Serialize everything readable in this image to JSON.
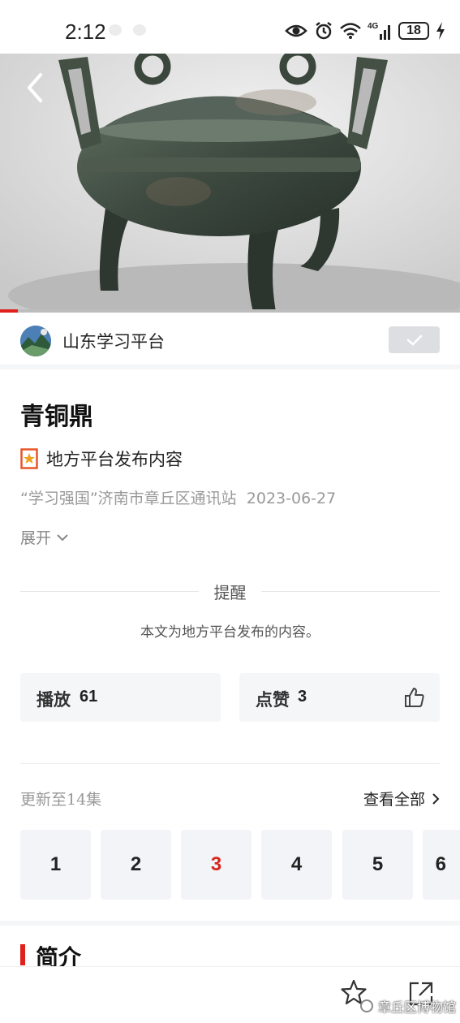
{
  "status_bar": {
    "time": "2:12",
    "network": "4G",
    "battery": "18"
  },
  "channel": {
    "name": "山东学习平台"
  },
  "article": {
    "title": "青铜鼎",
    "tag": "地方平台发布内容",
    "source": "“学习强国”济南市章丘区通讯站",
    "date": "2023-06-27",
    "expand_label": "展开"
  },
  "notice": {
    "title": "提醒",
    "body": "本文为地方平台发布的内容。"
  },
  "stats": {
    "play_label": "播放",
    "play_count": "61",
    "like_label": "点赞",
    "like_count": "3"
  },
  "episodes": {
    "update_text": "更新至14集",
    "view_all": "查看全部",
    "items": [
      "1",
      "2",
      "3",
      "4",
      "5",
      "6"
    ],
    "active": "3"
  },
  "intro": {
    "title": "简介"
  },
  "watermark": "章丘区博物馆",
  "colors": {
    "accent": "#e0201b",
    "follow_bg": "#dcdee2",
    "card_bg": "#f5f6f8"
  },
  "icons": [
    "eye-icon",
    "alarm-icon",
    "wifi-icon",
    "signal-icon",
    "battery-icon",
    "charging-icon",
    "back-icon",
    "check-icon",
    "badge-icon",
    "chevron-down-icon",
    "thumbs-up-icon",
    "chevron-right-icon",
    "star-icon",
    "share-icon"
  ]
}
